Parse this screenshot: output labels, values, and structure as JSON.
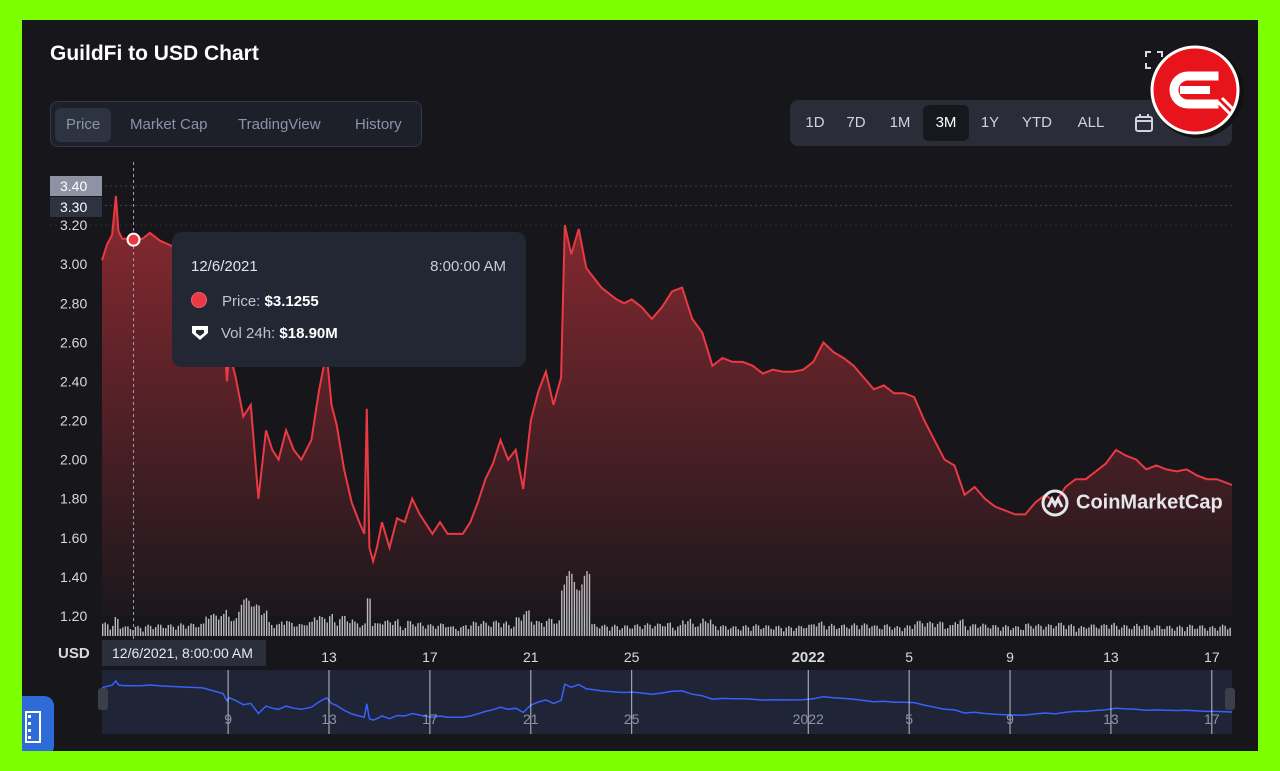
{
  "title": "GuildFi to USD Chart",
  "tabs": [
    {
      "label": "Price",
      "active": true
    },
    {
      "label": "Market Cap",
      "active": false
    },
    {
      "label": "TradingView",
      "active": false
    },
    {
      "label": "History",
      "active": false
    }
  ],
  "ranges": [
    {
      "label": "1D",
      "active": false
    },
    {
      "label": "7D",
      "active": false
    },
    {
      "label": "1M",
      "active": false
    },
    {
      "label": "3M",
      "active": true
    },
    {
      "label": "1Y",
      "active": false
    },
    {
      "label": "YTD",
      "active": false
    },
    {
      "label": "ALL",
      "active": false
    }
  ],
  "icons": {
    "calendar": "calendar-icon",
    "fullscreen": "fullscreen-icon",
    "badge": "channel-logo-badge"
  },
  "tooltip": {
    "date": "12/6/2021",
    "time": "8:00:00 AM",
    "price_label": "Price:",
    "price_value": "$3.1255",
    "vol_label": "Vol 24h:",
    "vol_value": "$18.90M"
  },
  "cursor_date": "12/6/2021, 8:00:00 AM",
  "currency": "USD",
  "watermark": "CoinMarketCap",
  "colors": {
    "price_line": "#ea3943",
    "navigator_line": "#3861fb",
    "background": "#17171b",
    "frame": "#7cff00"
  },
  "chart_data": {
    "type": "line",
    "title": "GuildFi to USD Chart",
    "ylabel": "USD",
    "yticks": [
      "1.20",
      "1.40",
      "1.60",
      "1.80",
      "2.00",
      "2.20",
      "2.40",
      "2.60",
      "2.80",
      "3.00",
      "3.20"
    ],
    "ytick_highlight": [
      "3.30",
      "3.40"
    ],
    "ylim": [
      1.2,
      3.4
    ],
    "xlim": [
      4.0,
      48.8
    ],
    "xticks": [
      {
        "label": "13",
        "x": 13
      },
      {
        "label": "17",
        "x": 17
      },
      {
        "label": "21",
        "x": 21
      },
      {
        "label": "25",
        "x": 25
      },
      {
        "label": "2022",
        "x": 32,
        "bold": true
      },
      {
        "label": "5",
        "x": 36
      },
      {
        "label": "9",
        "x": 40
      },
      {
        "label": "13",
        "x": 44
      },
      {
        "label": "17",
        "x": 48
      }
    ],
    "nav_xticks": [
      {
        "label": "9",
        "x": 9
      },
      {
        "label": "13",
        "x": 13
      },
      {
        "label": "17",
        "x": 17
      },
      {
        "label": "21",
        "x": 21
      },
      {
        "label": "25",
        "x": 25
      },
      {
        "label": "2022",
        "x": 32
      },
      {
        "label": "5",
        "x": 36
      },
      {
        "label": "9",
        "x": 40
      },
      {
        "label": "13",
        "x": 44
      },
      {
        "label": "17",
        "x": 48
      }
    ],
    "hover_point": {
      "x": 5.25,
      "y": 3.1255
    },
    "series": [
      {
        "x": [
          4.0,
          4.2,
          4.4,
          4.55,
          4.65,
          4.8,
          5.0,
          5.25,
          5.6,
          5.9,
          6.3,
          7.0,
          8.0,
          8.8,
          8.95,
          9.05,
          9.3,
          9.6,
          9.9,
          10.2,
          10.5,
          10.75,
          11.0,
          11.3,
          11.6,
          11.9,
          12.3,
          12.6,
          12.9,
          13.1,
          13.3,
          13.6,
          13.9,
          14.2,
          14.4,
          14.5,
          14.6,
          14.75,
          14.9,
          15.1,
          15.4,
          15.7,
          16.0,
          16.3,
          16.6,
          16.9,
          17.1,
          17.4,
          17.7,
          18.0,
          18.3,
          18.6,
          18.9,
          19.2,
          19.5,
          19.8,
          20.1,
          20.4,
          20.7,
          21.0,
          21.3,
          21.6,
          21.9,
          22.2,
          22.35,
          22.6,
          22.9,
          23.2,
          23.5,
          23.8,
          24.1,
          24.4,
          24.7,
          25.0,
          25.4,
          25.8,
          26.2,
          26.6,
          27.0,
          27.4,
          27.8,
          28.2,
          28.6,
          29.0,
          29.4,
          29.8,
          30.2,
          30.6,
          31.0,
          31.4,
          31.8,
          32.2,
          32.6,
          33.0,
          33.4,
          33.8,
          34.2,
          34.6,
          35.0,
          35.4,
          35.8,
          36.2,
          36.6,
          37.0,
          37.4,
          37.8,
          38.2,
          38.6,
          39.0,
          39.4,
          39.8,
          40.2,
          40.6,
          41.0,
          41.4,
          41.8,
          42.2,
          42.6,
          43.0,
          43.4,
          43.8,
          44.2,
          44.6,
          45.0,
          45.4,
          45.8,
          46.2,
          46.6,
          47.0,
          47.4,
          47.8,
          48.2,
          48.8
        ],
        "values": [
          3.02,
          3.1,
          3.15,
          3.35,
          3.17,
          3.13,
          3.13,
          3.1255,
          3.13,
          3.16,
          3.12,
          3.08,
          3.02,
          2.75,
          2.4,
          2.55,
          2.42,
          2.22,
          2.28,
          1.8,
          2.15,
          2.05,
          2.0,
          2.15,
          2.05,
          2.0,
          2.1,
          2.35,
          2.55,
          2.28,
          2.18,
          1.95,
          1.78,
          1.68,
          1.62,
          2.26,
          1.55,
          1.48,
          1.55,
          1.68,
          1.55,
          1.7,
          1.68,
          1.8,
          1.72,
          1.66,
          1.62,
          1.68,
          1.62,
          1.62,
          1.62,
          1.68,
          1.78,
          1.9,
          1.98,
          2.1,
          2.0,
          2.05,
          1.85,
          2.2,
          2.35,
          2.45,
          2.28,
          2.42,
          3.2,
          3.05,
          3.18,
          2.98,
          2.93,
          2.88,
          2.85,
          2.82,
          2.8,
          2.82,
          2.78,
          2.72,
          2.78,
          2.86,
          2.88,
          2.72,
          2.65,
          2.48,
          2.52,
          2.5,
          2.5,
          2.48,
          2.44,
          2.46,
          2.45,
          2.45,
          2.46,
          2.5,
          2.6,
          2.55,
          2.52,
          2.48,
          2.42,
          2.36,
          2.38,
          2.34,
          2.34,
          2.32,
          2.2,
          2.1,
          2.0,
          1.97,
          1.82,
          1.86,
          1.8,
          1.76,
          1.74,
          1.72,
          1.72,
          1.78,
          1.82,
          1.78,
          1.86,
          1.9,
          1.9,
          1.94,
          1.98,
          2.05,
          2.02,
          2.0,
          1.95,
          1.97,
          1.95,
          1.94,
          1.95,
          1.92,
          1.9,
          1.9,
          1.87
        ]
      }
    ]
  }
}
